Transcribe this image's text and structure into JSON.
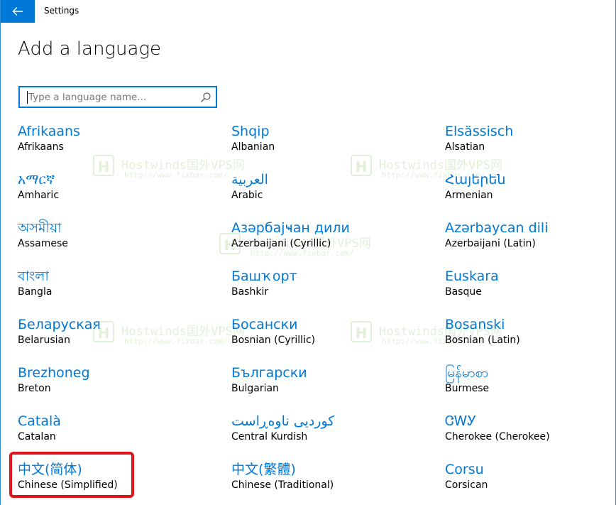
{
  "window": {
    "title": "Settings"
  },
  "page": {
    "title": "Add a language"
  },
  "search": {
    "placeholder": "Type a language name..."
  },
  "languages": [
    {
      "native": "Afrikaans",
      "english": "Afrikaans"
    },
    {
      "native": "Shqip",
      "english": "Albanian"
    },
    {
      "native": "Elsässisch",
      "english": "Alsatian"
    },
    {
      "native": "አማርኛ",
      "english": "Amharic"
    },
    {
      "native": "العربية",
      "english": "Arabic"
    },
    {
      "native": "Հայերեն",
      "english": "Armenian"
    },
    {
      "native": "অসমীয়া",
      "english": "Assamese"
    },
    {
      "native": "Азәрбајҹан дили",
      "english": "Azerbaijani (Cyrillic)"
    },
    {
      "native": "Azərbaycan dili",
      "english": "Azerbaijani (Latin)"
    },
    {
      "native": "বাংলা",
      "english": "Bangla"
    },
    {
      "native": "Башҡорт",
      "english": "Bashkir"
    },
    {
      "native": "Euskara",
      "english": "Basque"
    },
    {
      "native": "Беларуская",
      "english": "Belarusian"
    },
    {
      "native": "Босански",
      "english": "Bosnian (Cyrillic)"
    },
    {
      "native": "Bosanski",
      "english": "Bosnian (Latin)"
    },
    {
      "native": "Brezhoneg",
      "english": "Breton"
    },
    {
      "native": "Български",
      "english": "Bulgarian"
    },
    {
      "native": "မြန်မာစာ",
      "english": "Burmese"
    },
    {
      "native": "Català",
      "english": "Catalan"
    },
    {
      "native": "کوردیی ناوەڕاست",
      "english": "Central Kurdish"
    },
    {
      "native": "ᏣᎳᎩ",
      "english": "Cherokee (Cherokee)"
    },
    {
      "native": "中文(简体)",
      "english": "Chinese (Simplified)"
    },
    {
      "native": "中文(繁體)",
      "english": "Chinese (Traditional)"
    },
    {
      "native": "Corsu",
      "english": "Corsican"
    }
  ],
  "highlighted_language": "Chinese (Simplified)",
  "watermark": {
    "brand": "Hostwinds国外VPS网",
    "url": "http://www.fixbar.com/",
    "logo": "H"
  },
  "icons": {
    "back": "back-arrow-icon",
    "search": "search-icon"
  },
  "colors": {
    "accent": "#0078d7",
    "highlight": "#e0131a",
    "watermark": "#7bbf5a"
  }
}
